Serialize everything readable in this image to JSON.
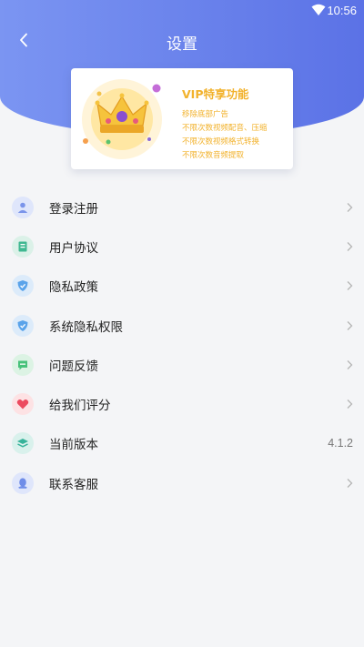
{
  "status_bar": {
    "time": "10:56",
    "wifi_icon": "wifi-icon"
  },
  "header": {
    "title": "设置",
    "back_icon": "chevron-left-icon",
    "gradient": [
      "#7b95f2",
      "#5b72e6"
    ]
  },
  "vip_card": {
    "title": "VIP特享功能",
    "features": [
      "移除底部广告",
      "不限次数视频配音、压缩",
      "不限次数视频格式转换",
      "不限次数音频提取"
    ],
    "accent_color": "#f2b22c",
    "icon": "crown-icon"
  },
  "menu": {
    "items": [
      {
        "label": "登录注册",
        "icon": "user-icon",
        "icon_bg": "#dfe6fb",
        "icon_color": "#7a94ea",
        "trailing": "chevron"
      },
      {
        "label": "用户协议",
        "icon": "document-icon",
        "icon_bg": "#dbf1e8",
        "icon_color": "#3fb891",
        "trailing": "chevron"
      },
      {
        "label": "隐私政策",
        "icon": "shield-icon",
        "icon_bg": "#dcebfa",
        "icon_color": "#5aa3ea",
        "trailing": "chevron"
      },
      {
        "label": "系统隐私权限",
        "icon": "shield-icon",
        "icon_bg": "#dcebfa",
        "icon_color": "#5aa3ea",
        "trailing": "chevron"
      },
      {
        "label": "问题反馈",
        "icon": "message-icon",
        "icon_bg": "#dcf3e4",
        "icon_color": "#47c27a",
        "trailing": "chevron"
      },
      {
        "label": "给我们评分",
        "icon": "heart-icon",
        "icon_bg": "#fde2e4",
        "icon_color": "#ec4a5f",
        "trailing": "chevron"
      },
      {
        "label": "当前版本",
        "icon": "layers-icon",
        "icon_bg": "#d9f1ec",
        "icon_color": "#37b39a",
        "trailing": "value",
        "value": "4.1.2"
      },
      {
        "label": "联系客服",
        "icon": "qq-icon",
        "icon_bg": "#dfe6fb",
        "icon_color": "#6f8de8",
        "trailing": "chevron"
      }
    ]
  }
}
